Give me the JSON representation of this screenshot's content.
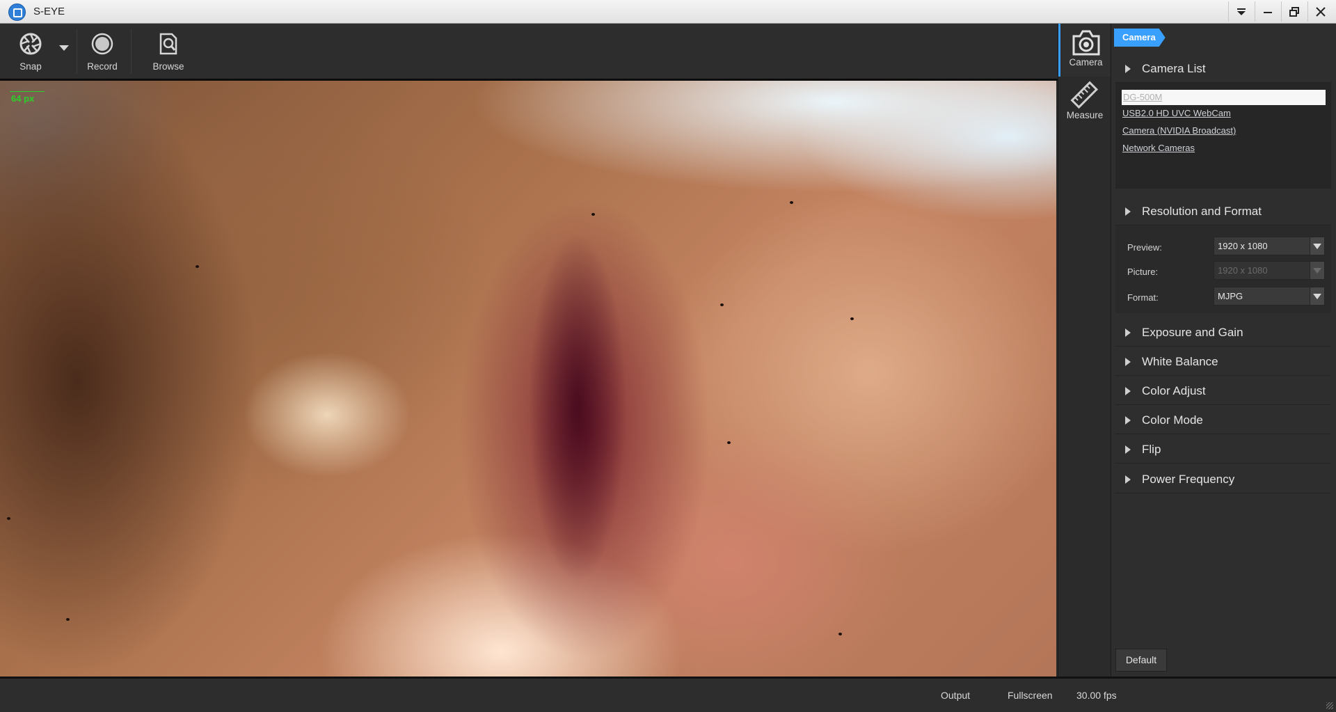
{
  "window": {
    "title": "S-EYE"
  },
  "toolbar": {
    "snap_label": "Snap",
    "record_label": "Record",
    "browse_label": "Browse"
  },
  "feed": {
    "scale_label": "64 px"
  },
  "sidetabs": [
    {
      "label": "Camera",
      "icon": "camera-icon",
      "active": true
    },
    {
      "label": "Measure",
      "icon": "ruler-icon",
      "active": false
    }
  ],
  "panel": {
    "breadcrumb": "Camera",
    "camera_list": {
      "title": "Camera List",
      "items": [
        "DG-500M",
        "USB2.0 HD UVC WebCam",
        "Camera (NVIDIA Broadcast)",
        "Network Cameras"
      ],
      "selected": "DG-500M"
    },
    "resolution": {
      "title": "Resolution and Format",
      "preview_label": "Preview:",
      "preview_value": "1920 x 1080",
      "picture_label": "Picture:",
      "picture_value": "1920 x 1080",
      "format_label": "Format:",
      "format_value": "MJPG"
    },
    "sections": [
      "Exposure and Gain",
      "White Balance",
      "Color Adjust",
      "Color Mode",
      "Flip",
      "Power Frequency"
    ],
    "default_label": "Default"
  },
  "status": {
    "output_label": "Output",
    "fullscreen_label": "Fullscreen",
    "fps": "30.00 fps"
  },
  "colors": {
    "accent": "#3aa0ff",
    "scale": "#2bd12b"
  }
}
